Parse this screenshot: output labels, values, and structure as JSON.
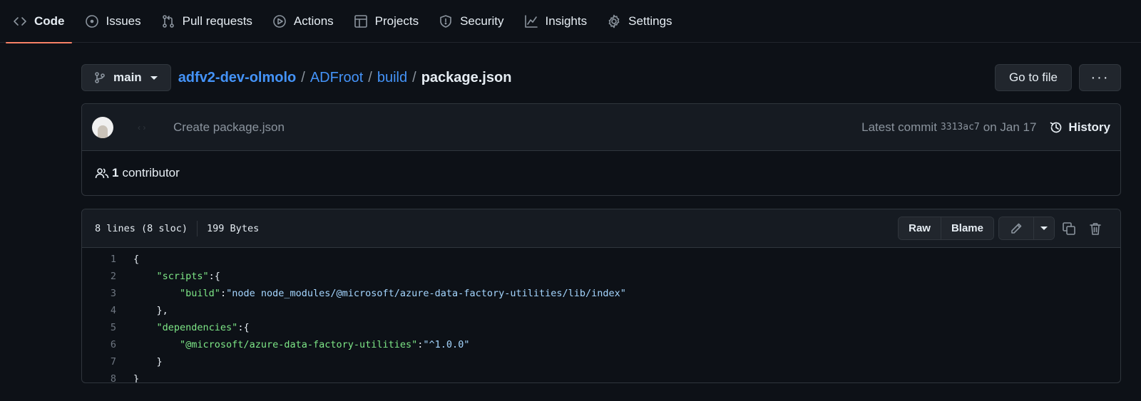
{
  "nav": {
    "tabs": [
      {
        "label": "Code",
        "icon": "code-icon",
        "active": true
      },
      {
        "label": "Issues",
        "icon": "issue-icon"
      },
      {
        "label": "Pull requests",
        "icon": "pull-request-icon"
      },
      {
        "label": "Actions",
        "icon": "play-icon"
      },
      {
        "label": "Projects",
        "icon": "table-icon"
      },
      {
        "label": "Security",
        "icon": "shield-icon"
      },
      {
        "label": "Insights",
        "icon": "graph-icon"
      },
      {
        "label": "Settings",
        "icon": "gear-icon"
      }
    ]
  },
  "breadcrumb": {
    "branch": "main",
    "repo": "adfv2-dev-olmolo",
    "folder1": "ADFroot",
    "folder2": "build",
    "sep": "/",
    "file": "package.json",
    "goto_label": "Go to file",
    "more_label": "···"
  },
  "commit": {
    "author": "‹ ›",
    "message": "Create package.json",
    "latest_label": "Latest commit",
    "sha": "3313ac7",
    "date": "on Jan 17",
    "history_label": "History"
  },
  "contributors": {
    "count": "1",
    "label": "contributor"
  },
  "file": {
    "lines_info": "8 lines (8 sloc)",
    "size": "199 Bytes",
    "raw_label": "Raw",
    "blame_label": "Blame"
  },
  "code": [
    {
      "n": "1",
      "parts": [
        [
          "p",
          "{"
        ]
      ]
    },
    {
      "n": "2",
      "parts": [
        [
          "p",
          "    "
        ],
        [
          "k",
          "\"scripts\""
        ],
        [
          "p",
          ":{"
        ]
      ]
    },
    {
      "n": "3",
      "parts": [
        [
          "p",
          "        "
        ],
        [
          "k",
          "\"build\""
        ],
        [
          "p",
          ":"
        ],
        [
          "s",
          "\"node node_modules/@microsoft/azure-data-factory-utilities/lib/index\""
        ]
      ]
    },
    {
      "n": "4",
      "parts": [
        [
          "p",
          "    },"
        ]
      ]
    },
    {
      "n": "5",
      "parts": [
        [
          "p",
          "    "
        ],
        [
          "k",
          "\"dependencies\""
        ],
        [
          "p",
          ":{"
        ]
      ]
    },
    {
      "n": "6",
      "parts": [
        [
          "p",
          "        "
        ],
        [
          "k",
          "\"@microsoft/azure-data-factory-utilities\""
        ],
        [
          "p",
          ":"
        ],
        [
          "s",
          "\"^1.0.0\""
        ]
      ]
    },
    {
      "n": "7",
      "parts": [
        [
          "p",
          "    }"
        ]
      ]
    },
    {
      "n": "8",
      "parts": [
        [
          "p",
          "}"
        ]
      ]
    }
  ],
  "colors": {
    "background": "#0d1117",
    "accent": "#f78166",
    "link": "#4493f8",
    "json_key": "#7ee787",
    "json_string": "#a5d6ff"
  }
}
